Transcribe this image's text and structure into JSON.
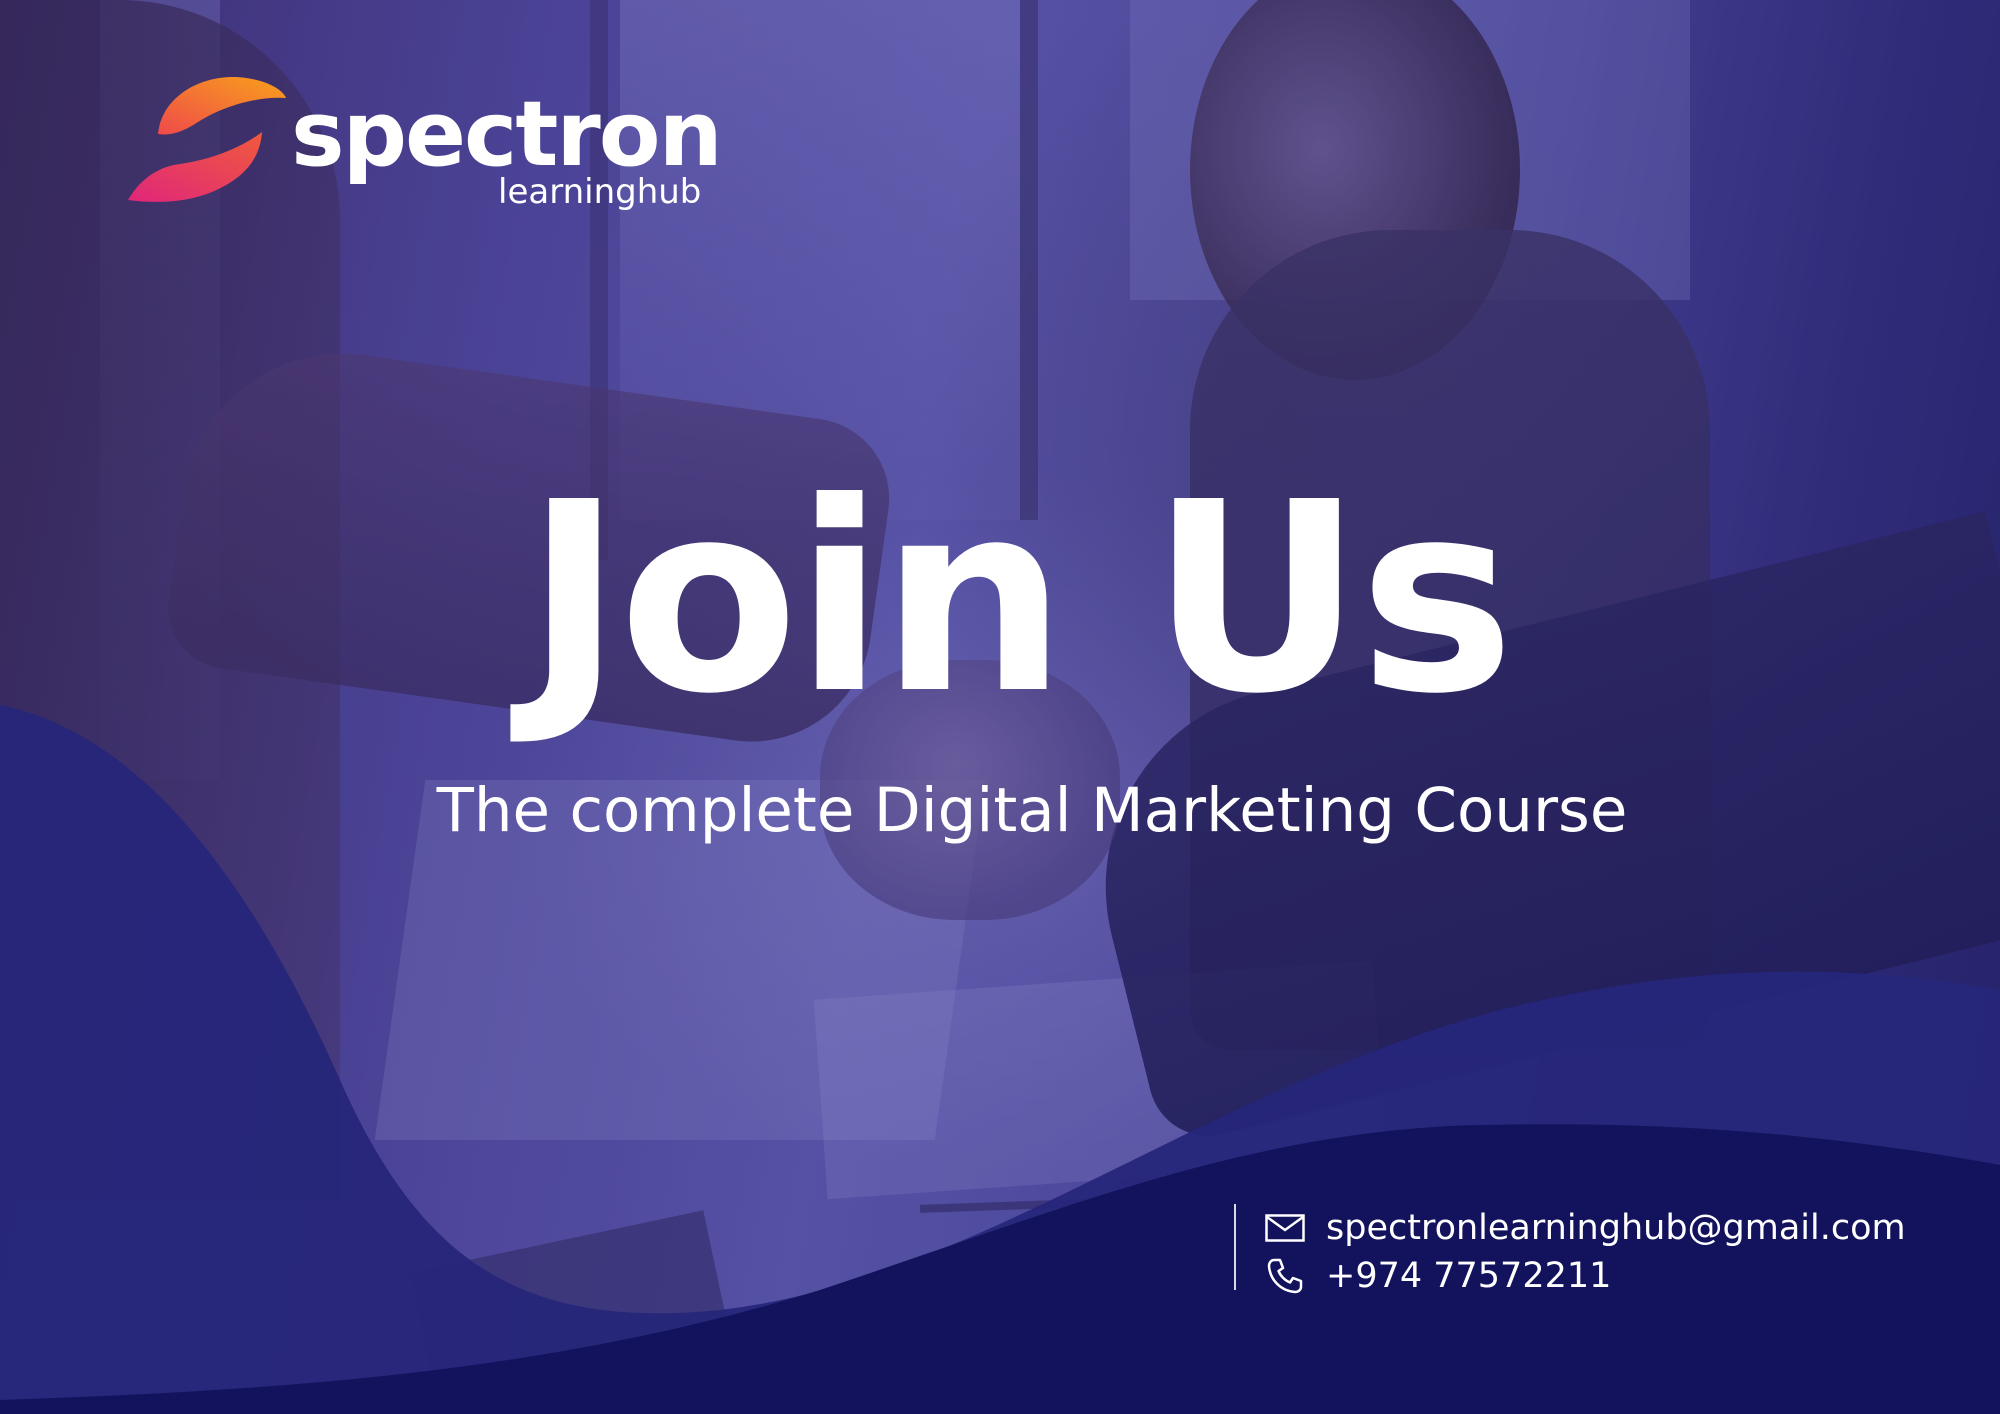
{
  "brand": {
    "name": "spectron",
    "tagline": "learninghub",
    "colors": {
      "logo_orange": "#f7941d",
      "logo_red": "#ee4266",
      "logo_pink": "#e2297a"
    }
  },
  "hero": {
    "headline": "Join Us",
    "subheadline": "The complete Digital Marketing Course"
  },
  "contact": {
    "email": "spectronlearninghub@gmail.com",
    "phone": "+974 77572211",
    "email_icon": "envelope-icon",
    "phone_icon": "phone-icon"
  },
  "theme": {
    "overlay": "#4a4a9c",
    "wave_light": "#27277a",
    "wave_dark": "#12115a",
    "text": "#ffffff"
  }
}
